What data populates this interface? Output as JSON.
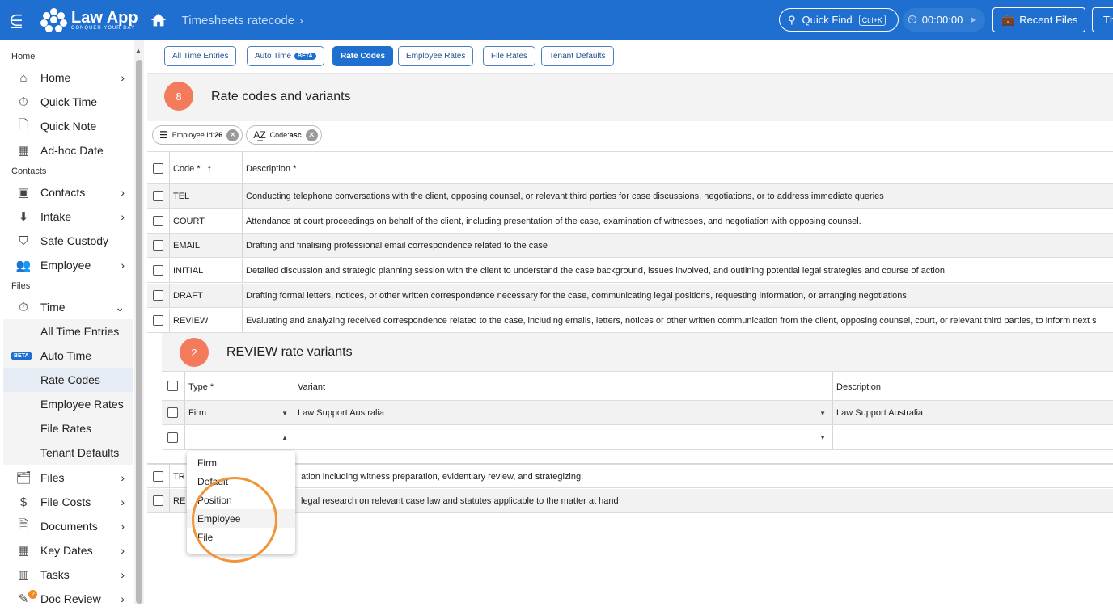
{
  "header": {
    "app_name": "Law App",
    "tagline": "CONQUER YOUR DAY",
    "breadcrumb": "Timesheets ratecode",
    "quick_find": "Quick Find",
    "quick_find_kbd": "Ctrl+K",
    "timer": "00:00:00",
    "recent_files": "Recent Files",
    "th_button": "Th"
  },
  "sidebar": {
    "sections": {
      "home": "Home",
      "contacts": "Contacts",
      "files": "Files"
    },
    "home_items": [
      "Home",
      "Quick Time",
      "Quick Note",
      "Ad-hoc Date"
    ],
    "contact_items": [
      "Contacts",
      "Intake",
      "Safe Custody",
      "Employee"
    ],
    "time_label": "Time",
    "time_sub": [
      "All Time Entries",
      "Auto Time",
      "Rate Codes",
      "Employee Rates",
      "File Rates",
      "Tenant Defaults"
    ],
    "beta": "BETA",
    "file_items": [
      "Files",
      "File Costs",
      "Documents",
      "Key Dates",
      "Tasks",
      "Doc Review"
    ],
    "doc_review_badge": "2"
  },
  "tabs": [
    "All Time Entries",
    "Auto Time",
    "Rate Codes",
    "Employee Rates",
    "File Rates",
    "Tenant Defaults"
  ],
  "tab_beta": "BETA",
  "rate_panel": {
    "count": "8",
    "title": "Rate codes and variants"
  },
  "filters": [
    {
      "label": "Employee Id:",
      "value": "26"
    },
    {
      "label": "Code:",
      "value": "asc"
    }
  ],
  "table": {
    "headers": {
      "code": "Code *",
      "description": "Description *"
    },
    "rows": [
      {
        "code": "TEL",
        "description": "Conducting telephone conversations with the client, opposing counsel, or relevant third parties for case discussions, negotiations, or to address immediate queries"
      },
      {
        "code": "COURT",
        "description": "Attendance at court proceedings on behalf of the client, including presentation of the case, examination of witnesses, and negotiation with opposing counsel."
      },
      {
        "code": "EMAIL",
        "description": "Drafting and finalising professional email correspondence related to the case"
      },
      {
        "code": "INITIAL",
        "description": "Detailed discussion and strategic planning session with the client to understand the case background, issues involved, and outlining potential legal strategies and course of action"
      },
      {
        "code": "DRAFT",
        "description": "Drafting formal letters, notices, or other written correspondence necessary for the case, communicating legal positions, requesting information, or arranging negotiations."
      },
      {
        "code": "REVIEW",
        "description": "Evaluating and analyzing received correspondence related to the case, including emails, letters, notices or other written communication from the client, opposing counsel, court, or relevant third parties, to inform next s"
      }
    ],
    "after_rows": [
      {
        "code": "TR",
        "description": "ation including witness preparation, evidentiary review, and strategizing."
      },
      {
        "code": "RE",
        "description": "legal research on relevant case law and statutes applicable to the matter at hand"
      }
    ]
  },
  "variants": {
    "count": "2",
    "title": "REVIEW rate variants",
    "headers": {
      "type": "Type *",
      "variant": "Variant",
      "description": "Description"
    },
    "row1": {
      "type": "Firm",
      "variant": "Law Support Australia",
      "description": "Law Support Australia"
    }
  },
  "dropdown_options": [
    "Firm",
    "Default",
    "Position",
    "Employee",
    "File"
  ]
}
